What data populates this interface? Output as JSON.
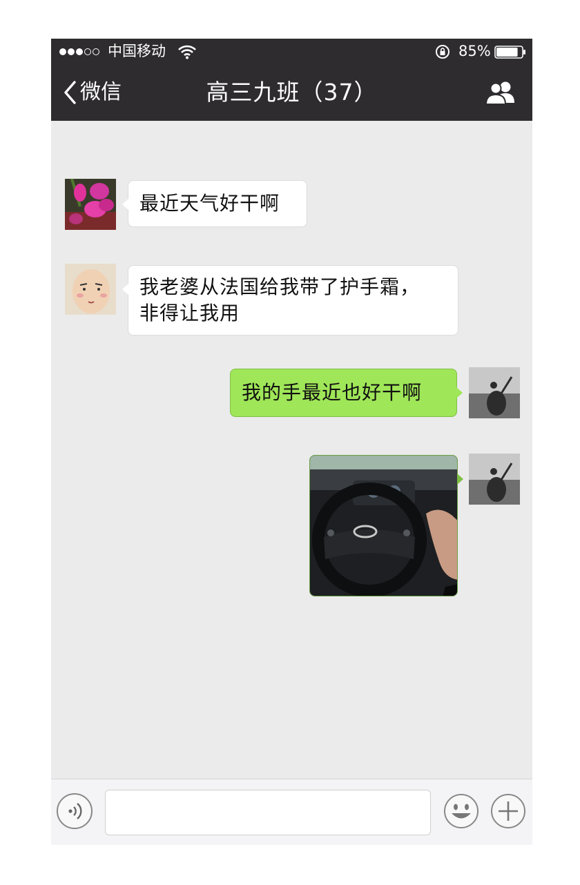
{
  "status_bar": {
    "signal_dots_filled": 3,
    "signal_dots_total": 5,
    "carrier": "中国移动",
    "battery": "85%",
    "battery_level": 0.85,
    "icons": [
      "wifi-icon",
      "rotation-lock-icon",
      "battery-icon"
    ]
  },
  "nav": {
    "back_label": "微信",
    "title": "高三九班（37）",
    "icons": [
      "chevron-left-icon",
      "group-members-icon"
    ]
  },
  "messages": [
    {
      "direction": "incoming",
      "avatar": "orchid-flower-avatar",
      "text": "最近天气好干啊"
    },
    {
      "direction": "incoming",
      "avatar": "cartoon-bald-man-avatar",
      "lines": [
        "我老婆从法国给我带了护手霜，",
        "非得让我用"
      ]
    },
    {
      "direction": "outgoing",
      "avatar": "silhouette-guitar-avatar",
      "text": "我的手最近也好干啊"
    },
    {
      "direction": "outgoing",
      "avatar": "silhouette-guitar-avatar",
      "image": "car-steering-wheel-photo"
    }
  ],
  "input_bar": {
    "placeholder": "",
    "icons": [
      "voice-icon",
      "emoji-icon",
      "plus-icon"
    ]
  },
  "colors": {
    "bar_background": "#2e2c2f",
    "chat_background": "#ebebeb",
    "outgoing_bubble": "#9fe658",
    "incoming_bubble": "#ffffff"
  }
}
